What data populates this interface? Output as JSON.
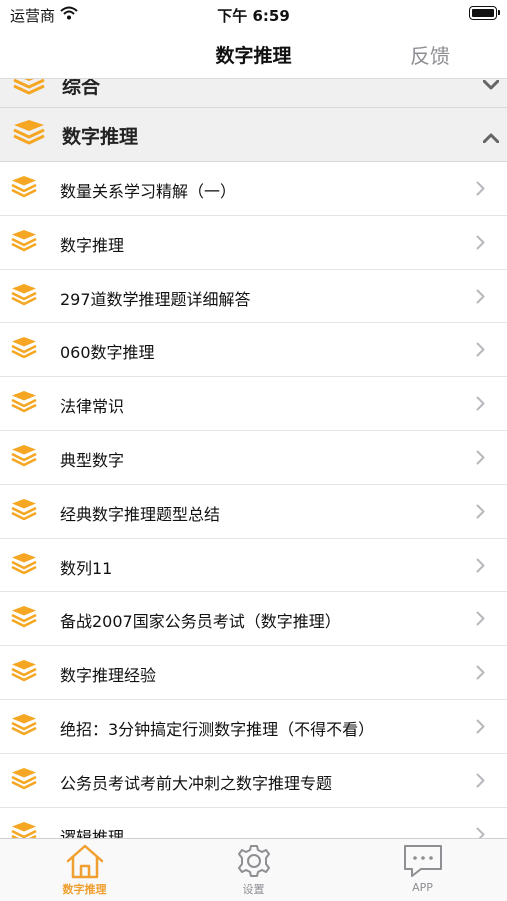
{
  "status_bar": {
    "carrier": "运营商",
    "time": "下午 6:59"
  },
  "navbar": {
    "title": "数字推理",
    "feedback_label": "反馈"
  },
  "sections": [
    {
      "label": "综合",
      "expanded": false
    },
    {
      "label": "数字推理",
      "expanded": true
    }
  ],
  "items": [
    {
      "label": "数量关系学习精解（一）"
    },
    {
      "label": "数字推理"
    },
    {
      "label": "297道数学推理题详细解答"
    },
    {
      "label": "060数字推理"
    },
    {
      "label": "法律常识"
    },
    {
      "label": "典型数字"
    },
    {
      "label": "经典数字推理题型总结"
    },
    {
      "label": "数列11"
    },
    {
      "label": "备战2007国家公务员考试（数字推理）"
    },
    {
      "label": "数字推理经验"
    },
    {
      "label": "绝招：3分钟搞定行测数字推理（不得不看）"
    },
    {
      "label": "公务员考试考前大冲刺之数字推理专题"
    },
    {
      "label": "逻辑推理"
    }
  ],
  "tabs": [
    {
      "label": "数字推理",
      "icon": "home-icon",
      "active": true
    },
    {
      "label": "设置",
      "icon": "gear-icon",
      "active": false
    },
    {
      "label": "APP",
      "icon": "chat-icon",
      "active": false
    }
  ],
  "colors": {
    "accent": "#f0a030",
    "icon_orange": "#f5a623",
    "section_bg": "#f0f0f0"
  }
}
